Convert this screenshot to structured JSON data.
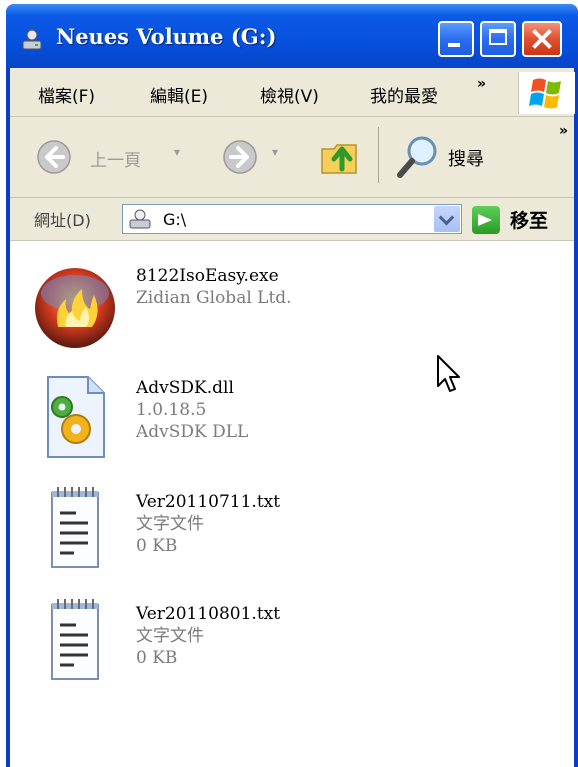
{
  "window": {
    "title": "Neues Volume (G:)"
  },
  "menu": {
    "items": [
      "檔案(F)",
      "編輯(E)",
      "檢視(V)",
      "我的最愛"
    ],
    "overflow": "»"
  },
  "toolbar": {
    "back_label": "上一頁",
    "search_label": "搜尋",
    "overflow": "»"
  },
  "address": {
    "label": "網址(D)",
    "value": "G:\\",
    "go_label": "移至"
  },
  "files": [
    {
      "name": "8122IsoEasy.exe",
      "details": [
        "Zidian Global Ltd."
      ],
      "icon": "burner-flame-icon"
    },
    {
      "name": "AdvSDK.dll",
      "details": [
        "1.0.18.5",
        "AdvSDK DLL"
      ],
      "icon": "dll-gear-icon"
    },
    {
      "name": "Ver20110711.txt",
      "details": [
        "文字文件",
        "0 KB"
      ],
      "icon": "text-file-icon"
    },
    {
      "name": "Ver20110801.txt",
      "details": [
        "文字文件",
        "0 KB"
      ],
      "icon": "text-file-icon"
    }
  ],
  "colors": {
    "titlebar": "#0650de",
    "chrome": "#ece9d8",
    "accent_close": "#e0502f"
  }
}
